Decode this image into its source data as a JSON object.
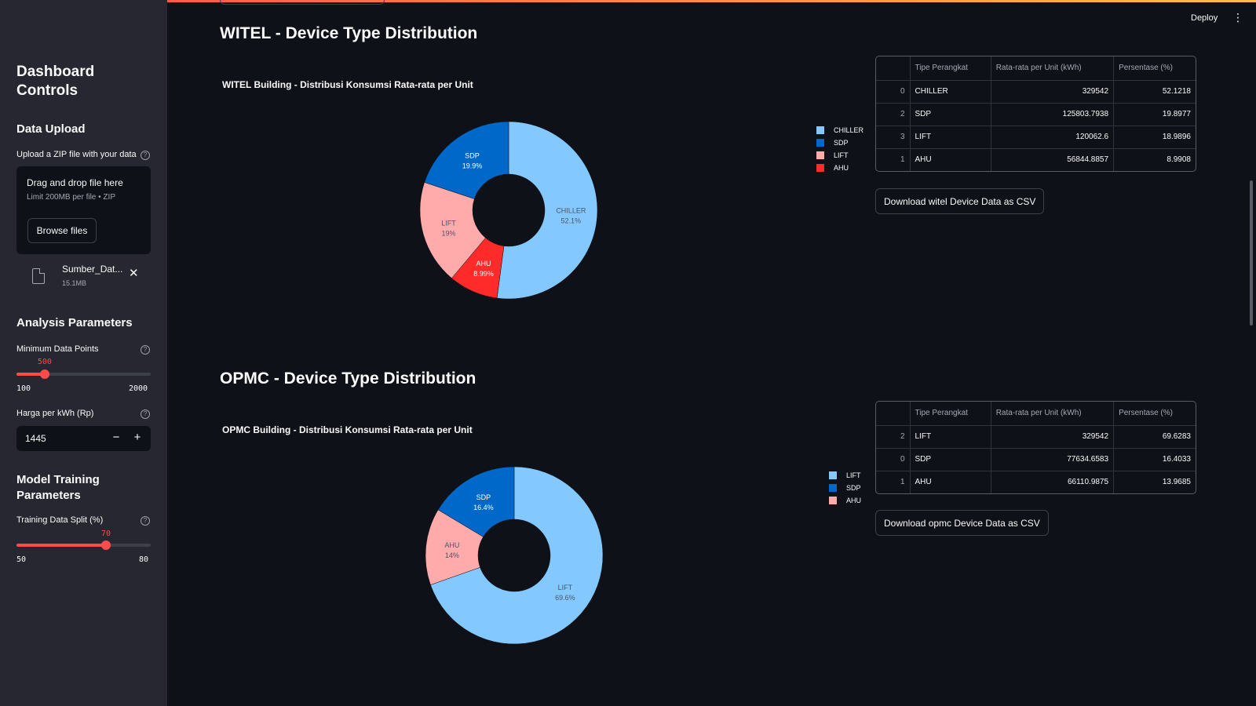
{
  "sidebar": {
    "title": "Dashboard Controls",
    "data_upload": {
      "heading": "Data Upload",
      "label": "Upload a ZIP file with your data",
      "dropzone_title": "Drag and drop file here",
      "dropzone_sub": "Limit 200MB per file • ZIP",
      "browse_label": "Browse files",
      "file_name": "Sumber_Dat...",
      "file_size": "15.1MB"
    },
    "analysis": {
      "heading": "Analysis Parameters",
      "min_points_label": "Minimum Data Points",
      "min_points_value": "500",
      "min_points_min": "100",
      "min_points_max": "2000",
      "min_points_fraction": 0.21,
      "price_label": "Harga per kWh (Rp)",
      "price_value": "1445"
    },
    "training": {
      "heading": "Model Training Parameters",
      "split_label": "Training Data Split (%)",
      "split_value": "70",
      "split_min": "50",
      "split_max": "80",
      "split_fraction": 0.667
    }
  },
  "header": {
    "deploy_label": "Deploy"
  },
  "colors": {
    "chiller": "#83c9ff",
    "sdp": "#0068c9",
    "lift_pink": "#ffabab",
    "ahu_red": "#ff2b2b"
  },
  "sections": [
    {
      "title": "WITEL - Device Type Distribution",
      "chart_title": "WITEL Building - Distribusi Konsumsi Rata-rata per Unit",
      "download_label": "Download witel Device Data as CSV",
      "table": {
        "headers": [
          "",
          "Tipe Perangkat",
          "Rata-rata per Unit (kWh)",
          "Persentase (%)"
        ],
        "rows": [
          [
            "0",
            "CHILLER",
            "329542",
            "52.1218"
          ],
          [
            "2",
            "SDP",
            "125803.7938",
            "19.8977"
          ],
          [
            "3",
            "LIFT",
            "120062.6",
            "18.9896"
          ],
          [
            "1",
            "AHU",
            "56844.8857",
            "8.9908"
          ]
        ]
      }
    },
    {
      "title": "OPMC - Device Type Distribution",
      "chart_title": "OPMC Building - Distribusi Konsumsi Rata-rata per Unit",
      "download_label": "Download opmc Device Data as CSV",
      "table": {
        "headers": [
          "",
          "Tipe Perangkat",
          "Rata-rata per Unit (kWh)",
          "Persentase (%)"
        ],
        "rows": [
          [
            "2",
            "LIFT",
            "329542",
            "69.6283"
          ],
          [
            "0",
            "SDP",
            "77634.6583",
            "16.4033"
          ],
          [
            "1",
            "AHU",
            "66110.9875",
            "13.9685"
          ]
        ]
      }
    }
  ],
  "chart_data": [
    {
      "type": "pie",
      "title": "WITEL Building - Distribusi Konsumsi Rata-rata per Unit",
      "categories": [
        "CHILLER",
        "SDP",
        "LIFT",
        "AHU"
      ],
      "values": [
        52.1,
        19.9,
        19,
        8.99
      ],
      "slice_labels": [
        [
          "CHILLER",
          "52.1%"
        ],
        [
          "AHU",
          "8.99%"
        ],
        [
          "LIFT",
          "19%"
        ],
        [
          "SDP",
          "19.9%"
        ]
      ],
      "slice_order": [
        "CHILLER",
        "AHU",
        "LIFT",
        "SDP"
      ],
      "slice_values": [
        52.1,
        8.99,
        19,
        19.9
      ],
      "slice_colors": [
        "#83c9ff",
        "#ff2b2b",
        "#ffabab",
        "#0068c9"
      ],
      "legend": [
        "CHILLER",
        "SDP",
        "LIFT",
        "AHU"
      ],
      "legend_colors": [
        "#83c9ff",
        "#0068c9",
        "#ffabab",
        "#ff2b2b"
      ],
      "legend_placement": "right"
    },
    {
      "type": "pie",
      "title": "OPMC Building - Distribusi Konsumsi Rata-rata per Unit",
      "categories": [
        "LIFT",
        "SDP",
        "AHU"
      ],
      "values": [
        69.6,
        16.4,
        14
      ],
      "slice_labels": [
        [
          "LIFT",
          "69.6%"
        ],
        [
          "AHU",
          "14%"
        ],
        [
          "SDP",
          "16.4%"
        ]
      ],
      "slice_order": [
        "LIFT",
        "AHU",
        "SDP"
      ],
      "slice_values": [
        69.6,
        14,
        16.4
      ],
      "slice_colors": [
        "#83c9ff",
        "#ffabab",
        "#0068c9"
      ],
      "legend": [
        "LIFT",
        "SDP",
        "AHU"
      ],
      "legend_colors": [
        "#83c9ff",
        "#0068c9",
        "#ffabab"
      ],
      "legend_placement": "right"
    }
  ]
}
